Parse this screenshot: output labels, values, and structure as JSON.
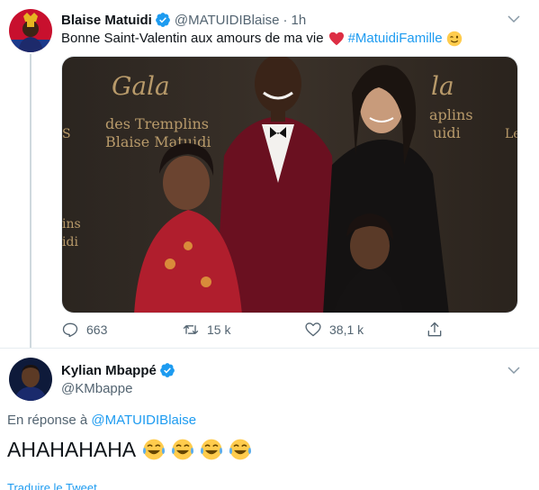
{
  "tweet": {
    "author_name": "Blaise Matuidi",
    "author_handle": "@MATUIDIBlaise",
    "separator": "·",
    "time": "1h",
    "text_before": "Bonne Saint-Valentin aux amours de ma vie",
    "hashtag": "#MatuidiFamille",
    "photo_banner_title": "Gala",
    "photo_banner_sub": "des Tremplins",
    "photo_banner_name": "Blaise Matuidi",
    "counts": {
      "replies": "663",
      "retweets": "15 k",
      "likes": "38,1 k"
    }
  },
  "reply": {
    "author_name": "Kylian Mbappé",
    "author_handle": "@KMbappe",
    "in_reply_prefix": "En réponse à",
    "in_reply_handle": "@MATUIDIBlaise",
    "text": "AHAHAHAHA",
    "translate_label": "Traduire le Tweet"
  },
  "icons": {
    "verified": "verified-badge-icon",
    "chevron": "chevron-down-icon",
    "reply": "reply-icon",
    "retweet": "retweet-icon",
    "like": "heart-outline-icon",
    "share": "share-icon",
    "heart_emoji": "red-heart-emoji",
    "wink_emoji": "wink-emoji",
    "laugh_emoji": "tears-of-joy-emoji"
  },
  "colors": {
    "link": "#1d9bf0",
    "text": "#0f1419",
    "muted": "#536471",
    "divider": "#e6ecf0"
  }
}
